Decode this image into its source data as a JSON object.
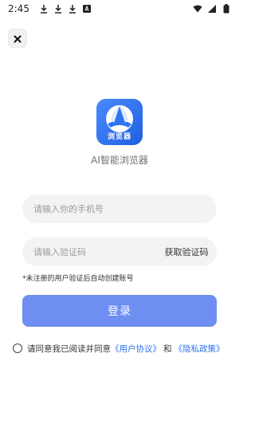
{
  "status_bar": {
    "time": "2:45",
    "icons": [
      "download-icon",
      "download-icon",
      "download-icon",
      "app-store-icon"
    ],
    "right_icons": [
      "wifi-icon",
      "signal-icon",
      "battery-icon"
    ]
  },
  "header": {
    "close_icon": "close-icon"
  },
  "app": {
    "logo_text": "浏览器",
    "name": "AI智能浏览器",
    "brand_color": "#2f74f3"
  },
  "form": {
    "phone": {
      "value": "",
      "placeholder": "请输入你的手机号"
    },
    "code": {
      "value": "",
      "placeholder": "请输入验证码"
    },
    "get_code_label": "获取验证码",
    "hint": "*未注册的用户验证后自动创建账号",
    "login_label": "登录",
    "login_color": "#6f8ef2"
  },
  "agreement": {
    "checked": false,
    "text": "请同意我已阅读并同意",
    "user_agreement": "《用户协议》",
    "and": "和",
    "privacy_policy": "《隐私政策》"
  }
}
